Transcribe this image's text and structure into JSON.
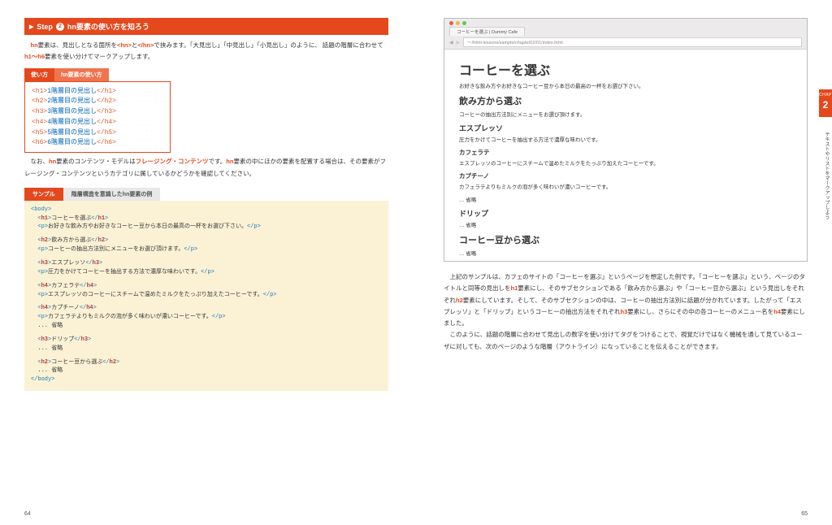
{
  "step": {
    "prefix": "Step",
    "number": "2",
    "title": "hn要素の使い方を知ろう"
  },
  "intro": {
    "l1a": "hn",
    "l1b": "要素は、見出しとなる箇所を",
    "l1c": "<hn>",
    "l1d": "と",
    "l1e": "</hn>",
    "l1f": "で挟みます。「大見出し」「中見出し」「小見出し」のように、",
    "l2a": "話題の階層に合わせて",
    "l2b": "h1～h6",
    "l2c": "要素を使い分けてマークアップします。"
  },
  "usage": {
    "tab1": "使い方",
    "tab2": "hn要素の使い方",
    "rows": [
      {
        "open": "<h1>",
        "text": "1階層目の見出し",
        "close": "</h1>"
      },
      {
        "open": "<h2>",
        "text": "2階層目の見出し",
        "close": "</h2>"
      },
      {
        "open": "<h3>",
        "text": "3階層目の見出し",
        "close": "</h3>"
      },
      {
        "open": "<h4>",
        "text": "4階層目の見出し",
        "close": "</h4>"
      },
      {
        "open": "<h5>",
        "text": "5階層目の見出し",
        "close": "</h5>"
      },
      {
        "open": "<h6>",
        "text": "6階層目の見出し",
        "close": "</h6>"
      }
    ]
  },
  "note": {
    "a": "なお、",
    "b": "hn",
    "c": "要素のコンテンツ・モデルは",
    "d": "フレージング・コンテンツ",
    "e": "です。",
    "f": "hn",
    "g": "要素の中にほかの要素を配置する場合は、その要素がフレージング・コンテンツというカテゴリに属しているかどうかを確認してください。"
  },
  "sample": {
    "tab_active": "サンプル",
    "tab_inactive": "階層構造を意識したhn要素の例",
    "code": [
      "<body>",
      "  <h1>コーヒーを選ぶ</h1>",
      "  <p>お好きな飲み方やお好きなコーヒー豆から本日の最高の一杯をお選び下さい。</p>",
      "",
      "  <h2>飲み方から選ぶ</h2>",
      "  <p>コーヒーの抽出方法別にメニューをお選び頂けます。</p>",
      "",
      "  <h3>エスプレッソ</h3>",
      "  <p>圧力をかけてコーヒーを抽出する方法で濃厚な味わいです。</p>",
      "",
      "  <h4>カフェラテ</h4>",
      "  <p>エスプレッソのコーヒーにスチームで温めたミルクをたっぷり加えたコーヒーです。</p>",
      "",
      "  <h4>カプチーノ</h4>",
      "  <p>カフェラテよりもミルクの泡が多く味わいが濃いコーヒーです。</p>",
      "  ... 省略",
      "",
      "  <h3>ドリップ</h3>",
      "  ... 省略",
      "",
      "  <h2>コーヒー豆から選ぶ</h2>",
      "  ... 省略",
      "</body>"
    ]
  },
  "browser": {
    "tab_title": "コーヒーを選ぶ | Dummy Cafe",
    "url": "～/html-lessons/sample/chapter02/01/index.html",
    "h1": "コーヒーを選ぶ",
    "p1": "お好きな飲み方やお好きなコーヒー豆から本日の最高の一杯をお選び下さい。",
    "h2a": "飲み方から選ぶ",
    "p2": "コーヒーの抽出方法別にメニューをお選び頂けます。",
    "h3a": "エスプレッソ",
    "p3": "圧力をかけてコーヒーを抽出する方法で濃厚な味わいです。",
    "h4a": "カフェラテ",
    "p4": "エスプレッソのコーヒーにスチームで温めたミルクをたっぷり加えたコーヒーです。",
    "h4b": "カプチーノ",
    "p5": "カフェラテよりもミルクの泡が多く味わいが濃いコーヒーです。",
    "om1": "… 省略",
    "h3b": "ドリップ",
    "om2": "… 省略",
    "h2b": "コーヒー豆から選ぶ",
    "om3": "… 省略"
  },
  "explain": {
    "p1a": "上記のサンプルは、カフェのサイトの「コーヒーを選ぶ」というページを想定した例です。「コーヒーを選ぶ」という、ページのタイトルと同等の見出しを",
    "p1b": "h1",
    "p1c": "要素にし、そのサブセクションである「飲み方から選ぶ」や「コーヒー豆から選ぶ」という見出しをそれぞれ",
    "p1d": "h2",
    "p1e": "要素にしています。そして、そのサブセクションの中は、コーヒーの抽出方法別に話題が分かれています。したがって「エスプレッソ」と「ドリップ」というコーヒーの抽出方法をそれぞれ",
    "p1f": "h3",
    "p1g": "要素にし、さらにその中の各コーヒーのメニュー名を",
    "p1h": "h4",
    "p1i": "要素にしました。",
    "p2": "このように、話題の階層に合わせて見出しの数字を使い分けてタグをつけることで、視覚だけではなく機械を通して見ているユーザに対しても、次のページのような階層（アウトライン）になっていることを伝えることができます。"
  },
  "side": {
    "chapter": "CHAPTER",
    "num": "2",
    "label": "テキストやリストをマークアップしよう"
  },
  "pages": {
    "left": "64",
    "right": "65"
  }
}
